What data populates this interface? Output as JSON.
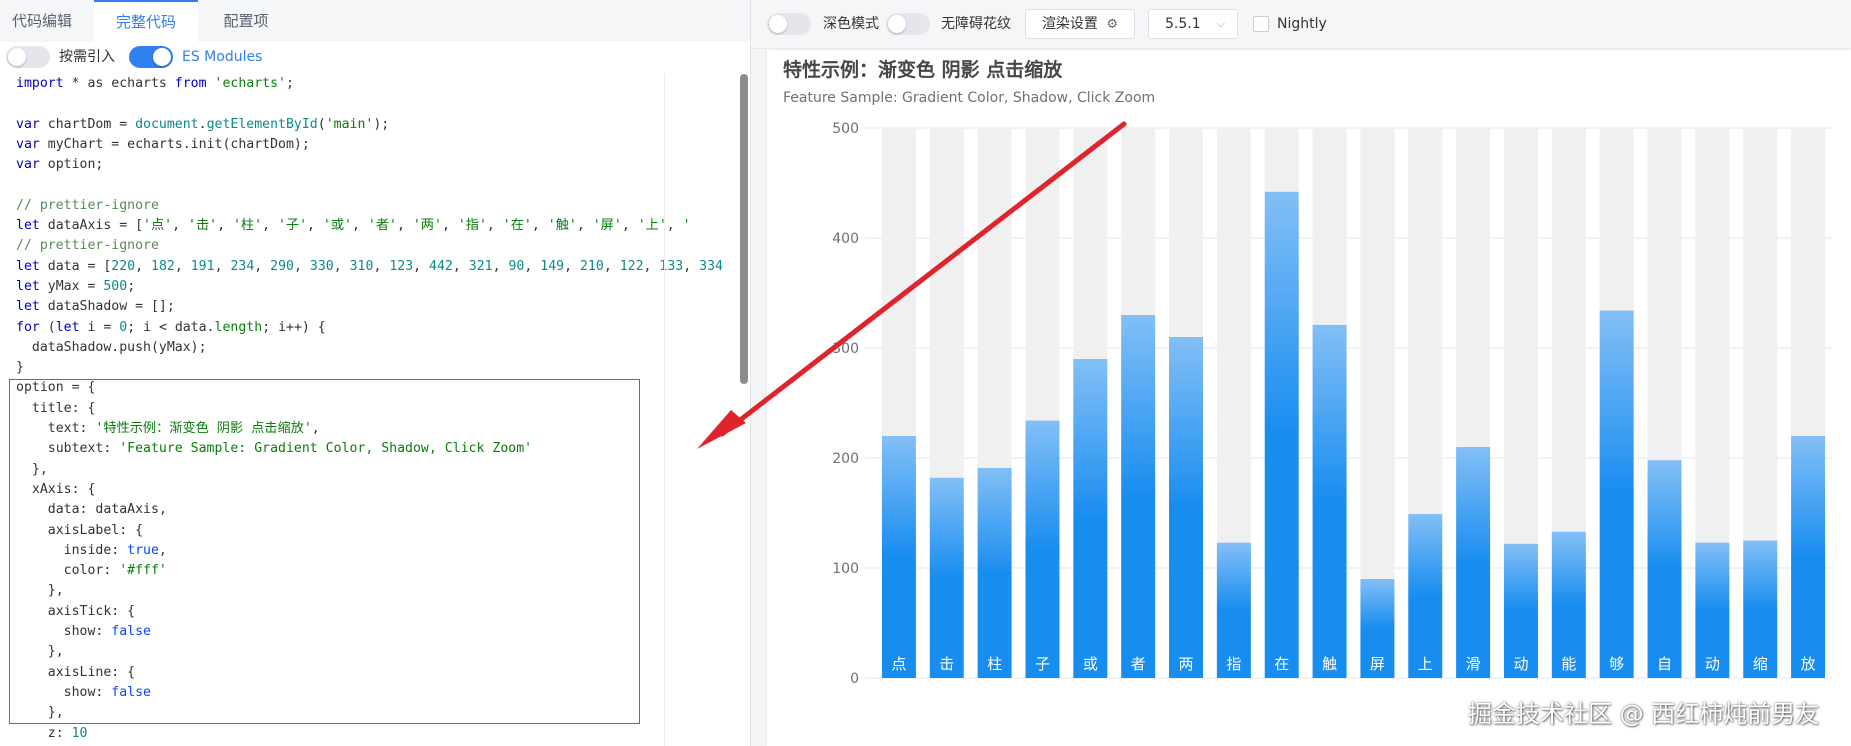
{
  "tabs": [
    {
      "label": "代码编辑",
      "active": false
    },
    {
      "label": "完整代码",
      "active": true
    },
    {
      "label": "配置项",
      "active": false
    }
  ],
  "toggles": {
    "on_demand_label": "按需引入",
    "es_modules_label": "ES Modules",
    "on_demand_on": false,
    "es_modules_on": true
  },
  "code_lines": [
    [
      {
        "t": "k",
        "v": "import"
      },
      {
        "t": "",
        "v": " * as echarts "
      },
      {
        "t": "k",
        "v": "from"
      },
      {
        "t": "",
        "v": " "
      },
      {
        "t": "s",
        "v": "'echarts'"
      },
      {
        "t": "",
        "v": ";"
      }
    ],
    [],
    [
      {
        "t": "k",
        "v": "var"
      },
      {
        "t": "",
        "v": " chartDom = "
      },
      {
        "t": "n",
        "v": "document"
      },
      {
        "t": "",
        "v": "."
      },
      {
        "t": "n",
        "v": "getElementById"
      },
      {
        "t": "",
        "v": "("
      },
      {
        "t": "s",
        "v": "'main'"
      },
      {
        "t": "",
        "v": ");"
      }
    ],
    [
      {
        "t": "k",
        "v": "var"
      },
      {
        "t": "",
        "v": " myChart = echarts.init(chartDom);"
      }
    ],
    [
      {
        "t": "k",
        "v": "var"
      },
      {
        "t": "",
        "v": " option;"
      }
    ],
    [],
    [
      {
        "t": "c",
        "v": "// prettier-ignore"
      }
    ],
    [
      {
        "t": "k",
        "v": "let"
      },
      {
        "t": "",
        "v": " dataAxis = ["
      },
      {
        "t": "s",
        "v": "'点'"
      },
      {
        "t": "",
        "v": ", "
      },
      {
        "t": "s",
        "v": "'击'"
      },
      {
        "t": "",
        "v": ", "
      },
      {
        "t": "s",
        "v": "'柱'"
      },
      {
        "t": "",
        "v": ", "
      },
      {
        "t": "s",
        "v": "'子'"
      },
      {
        "t": "",
        "v": ", "
      },
      {
        "t": "s",
        "v": "'或'"
      },
      {
        "t": "",
        "v": ", "
      },
      {
        "t": "s",
        "v": "'者'"
      },
      {
        "t": "",
        "v": ", "
      },
      {
        "t": "s",
        "v": "'两'"
      },
      {
        "t": "",
        "v": ", "
      },
      {
        "t": "s",
        "v": "'指'"
      },
      {
        "t": "",
        "v": ", "
      },
      {
        "t": "s",
        "v": "'在'"
      },
      {
        "t": "",
        "v": ", "
      },
      {
        "t": "s",
        "v": "'触'"
      },
      {
        "t": "",
        "v": ", "
      },
      {
        "t": "s",
        "v": "'屏'"
      },
      {
        "t": "",
        "v": ", "
      },
      {
        "t": "s",
        "v": "'上'"
      },
      {
        "t": "",
        "v": ", "
      },
      {
        "t": "s",
        "v": "'"
      }
    ],
    [
      {
        "t": "c",
        "v": "// prettier-ignore"
      }
    ],
    [
      {
        "t": "k",
        "v": "let"
      },
      {
        "t": "",
        "v": " data = ["
      },
      {
        "t": "n",
        "v": "220"
      },
      {
        "t": "",
        "v": ", "
      },
      {
        "t": "n",
        "v": "182"
      },
      {
        "t": "",
        "v": ", "
      },
      {
        "t": "n",
        "v": "191"
      },
      {
        "t": "",
        "v": ", "
      },
      {
        "t": "n",
        "v": "234"
      },
      {
        "t": "",
        "v": ", "
      },
      {
        "t": "n",
        "v": "290"
      },
      {
        "t": "",
        "v": ", "
      },
      {
        "t": "n",
        "v": "330"
      },
      {
        "t": "",
        "v": ", "
      },
      {
        "t": "n",
        "v": "310"
      },
      {
        "t": "",
        "v": ", "
      },
      {
        "t": "n",
        "v": "123"
      },
      {
        "t": "",
        "v": ", "
      },
      {
        "t": "n",
        "v": "442"
      },
      {
        "t": "",
        "v": ", "
      },
      {
        "t": "n",
        "v": "321"
      },
      {
        "t": "",
        "v": ", "
      },
      {
        "t": "n",
        "v": "90"
      },
      {
        "t": "",
        "v": ", "
      },
      {
        "t": "n",
        "v": "149"
      },
      {
        "t": "",
        "v": ", "
      },
      {
        "t": "n",
        "v": "210"
      },
      {
        "t": "",
        "v": ", "
      },
      {
        "t": "n",
        "v": "122"
      },
      {
        "t": "",
        "v": ", "
      },
      {
        "t": "n",
        "v": "133"
      },
      {
        "t": "",
        "v": ", "
      },
      {
        "t": "n",
        "v": "334"
      }
    ],
    [
      {
        "t": "k",
        "v": "let"
      },
      {
        "t": "",
        "v": " yMax = "
      },
      {
        "t": "n",
        "v": "500"
      },
      {
        "t": "",
        "v": ";"
      }
    ],
    [
      {
        "t": "k",
        "v": "let"
      },
      {
        "t": "",
        "v": " dataShadow = [];"
      }
    ],
    [
      {
        "t": "k",
        "v": "for"
      },
      {
        "t": "",
        "v": " ("
      },
      {
        "t": "k",
        "v": "let"
      },
      {
        "t": "",
        "v": " i = "
      },
      {
        "t": "n",
        "v": "0"
      },
      {
        "t": "",
        "v": "; i < data."
      },
      {
        "t": "f",
        "v": "length"
      },
      {
        "t": "",
        "v": "; i++) {"
      }
    ],
    [
      {
        "t": "",
        "v": "  dataShadow.push(yMax);"
      }
    ],
    [
      {
        "t": "",
        "v": "}"
      }
    ],
    [
      {
        "t": "",
        "v": "option = {"
      }
    ],
    [
      {
        "t": "",
        "v": "  title: {"
      }
    ],
    [
      {
        "t": "",
        "v": "    text: "
      },
      {
        "t": "s",
        "v": "'特性示例：渐变色 阴影 点击缩放'"
      },
      {
        "t": "",
        "v": ","
      }
    ],
    [
      {
        "t": "",
        "v": "    subtext: "
      },
      {
        "t": "s",
        "v": "'Feature Sample: Gradient Color, Shadow, Click Zoom'"
      }
    ],
    [
      {
        "t": "",
        "v": "  },"
      }
    ],
    [
      {
        "t": "",
        "v": "  xAxis: {"
      }
    ],
    [
      {
        "t": "",
        "v": "    data: dataAxis,"
      }
    ],
    [
      {
        "t": "",
        "v": "    axisLabel: {"
      }
    ],
    [
      {
        "t": "",
        "v": "      inside: "
      },
      {
        "t": "b",
        "v": "true"
      },
      {
        "t": "",
        "v": ","
      }
    ],
    [
      {
        "t": "",
        "v": "      color: "
      },
      {
        "t": "s",
        "v": "'#fff'"
      }
    ],
    [
      {
        "t": "",
        "v": "    },"
      }
    ],
    [
      {
        "t": "",
        "v": "    axisTick: {"
      }
    ],
    [
      {
        "t": "",
        "v": "      show: "
      },
      {
        "t": "b",
        "v": "false"
      }
    ],
    [
      {
        "t": "",
        "v": "    },"
      }
    ],
    [
      {
        "t": "",
        "v": "    axisLine: {"
      }
    ],
    [
      {
        "t": "",
        "v": "      show: "
      },
      {
        "t": "b",
        "v": "false"
      }
    ],
    [
      {
        "t": "",
        "v": "    },"
      }
    ],
    [
      {
        "t": "",
        "v": "    z: "
      },
      {
        "t": "n",
        "v": "10"
      }
    ]
  ],
  "toolbar": {
    "dark_mode_label": "深色模式",
    "accessible_label": "无障碍花纹",
    "render_settings_label": "渲染设置",
    "version_value": "5.5.1",
    "nightly_label": "Nightly",
    "gear_icon": "gear-icon",
    "chevron_icon": "chevron-down-icon"
  },
  "chart_data": {
    "type": "bar",
    "title": "特性示例：渐变色 阴影 点击缩放",
    "subtitle": "Feature Sample: Gradient Color, Shadow, Click Zoom",
    "categories": [
      "点",
      "击",
      "柱",
      "子",
      "或",
      "者",
      "两",
      "指",
      "在",
      "触",
      "屏",
      "上",
      "滑",
      "动",
      "能",
      "够",
      "自",
      "动",
      "缩",
      "放"
    ],
    "values": [
      220,
      182,
      191,
      234,
      290,
      330,
      310,
      123,
      442,
      321,
      90,
      149,
      210,
      122,
      133,
      334,
      198,
      123,
      125,
      220
    ],
    "shadow_value": 500,
    "ylim": [
      0,
      500
    ],
    "yticks": [
      0,
      100,
      200,
      300,
      400,
      500
    ],
    "grid": true,
    "bar_color_top": "#83bff6",
    "bar_color_mid": "#188df0",
    "bar_color_bottom": "#188df0",
    "shadow_color": "#f0f0f0",
    "label_color": "#ffffff"
  },
  "watermark": "掘金技术社区 @ 西红柿炖前男友",
  "arrow_color": "#e0242c"
}
